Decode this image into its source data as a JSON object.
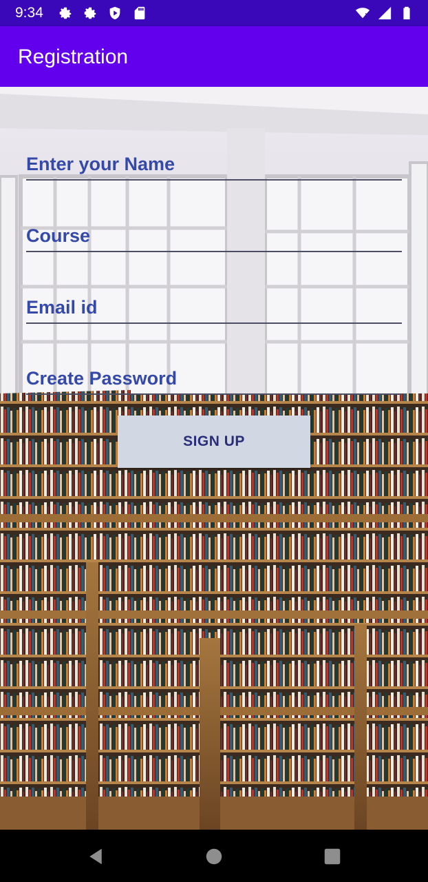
{
  "status_bar": {
    "time": "9:34",
    "left_icons": [
      "gear-icon",
      "gear-icon",
      "shield-icon",
      "sd-card-icon"
    ],
    "right_icons": [
      "wifi-icon",
      "signal-icon",
      "battery-icon"
    ]
  },
  "app_bar": {
    "title": "Registration",
    "color": "#6200ee"
  },
  "form": {
    "name_placeholder": "Enter your Name",
    "course_placeholder": "Course",
    "email_placeholder": "Email id",
    "password_placeholder": "Create Password"
  },
  "signup_button": {
    "label": "SIGN UP"
  },
  "background": {
    "description_icon": "library-bookshelves-photo"
  },
  "nav_bar": {
    "buttons": [
      "back-icon",
      "home-icon",
      "recents-icon"
    ]
  }
}
